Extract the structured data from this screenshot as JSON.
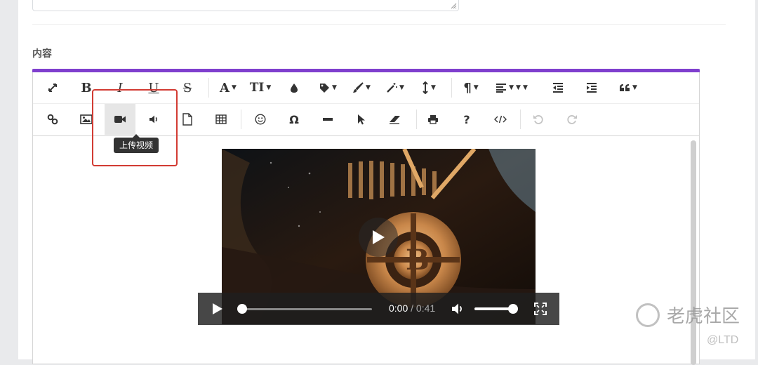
{
  "form": {
    "content_label": "内容"
  },
  "toolbar": {
    "row1": [
      {
        "name": "fullscreen-icon"
      },
      {
        "name": "bold-icon",
        "glyph": "B"
      },
      {
        "name": "italic-icon",
        "glyph": "I"
      },
      {
        "name": "underline-icon",
        "glyph": "U"
      },
      {
        "name": "strikethrough-icon",
        "glyph": "S"
      },
      {
        "name": "font-family-icon",
        "glyph": "A"
      },
      {
        "name": "font-size-icon",
        "glyph": "T"
      },
      {
        "name": "text-color-icon"
      },
      {
        "name": "tag-icon"
      },
      {
        "name": "paint-brush-icon"
      },
      {
        "name": "magic-wand-icon"
      },
      {
        "name": "line-height-icon"
      },
      {
        "name": "paragraph-icon",
        "glyph": "¶"
      },
      {
        "name": "align-icon"
      },
      {
        "name": "outdent-icon"
      },
      {
        "name": "indent-icon"
      },
      {
        "name": "quote-icon"
      }
    ],
    "row2": [
      {
        "name": "link-icon"
      },
      {
        "name": "image-icon"
      },
      {
        "name": "video-icon"
      },
      {
        "name": "audio-icon"
      },
      {
        "name": "file-icon"
      },
      {
        "name": "table-icon"
      },
      {
        "name": "emoji-icon"
      },
      {
        "name": "special-char-icon",
        "glyph": "Ω"
      },
      {
        "name": "horizontal-rule-icon"
      },
      {
        "name": "select-pointer-icon"
      },
      {
        "name": "eraser-icon"
      },
      {
        "name": "print-icon"
      },
      {
        "name": "help-icon",
        "glyph": "?"
      },
      {
        "name": "code-view-icon"
      },
      {
        "name": "undo-icon"
      },
      {
        "name": "redo-icon"
      }
    ],
    "active_button": "video-icon",
    "tooltip": "上传视频"
  },
  "video_player": {
    "current_time": "0:00",
    "separator": " / ",
    "duration": "0:41",
    "progress": 0,
    "volume": 0.9
  },
  "watermark": {
    "brand": "老虎社区",
    "handle": "@LTD"
  },
  "colors": {
    "accent": "#7f3fce",
    "highlight": "#d23b33"
  }
}
